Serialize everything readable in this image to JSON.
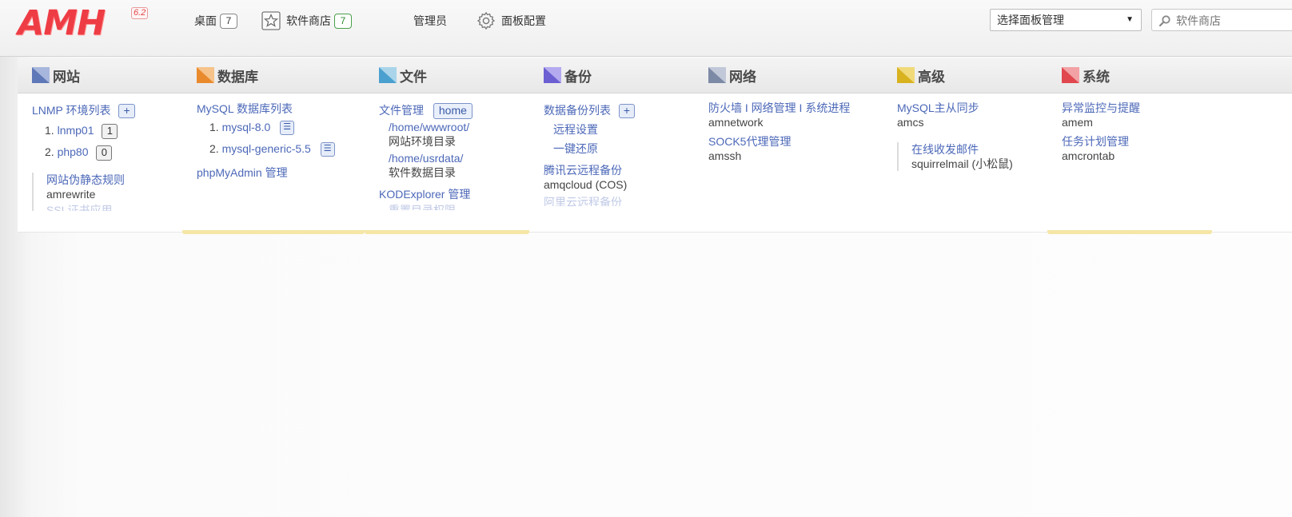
{
  "header": {
    "logo_text": "AMH",
    "version": "6.2",
    "nav": {
      "desktop": {
        "label": "桌面",
        "count": "7"
      },
      "store": {
        "label": "软件商店",
        "count": "7"
      },
      "admin": {
        "label": "管理员"
      },
      "config": {
        "label": "面板配置"
      }
    },
    "panel_select": {
      "selected": "选择面板管理"
    },
    "search": {
      "placeholder": "软件商店"
    }
  },
  "categories": {
    "website": "网站",
    "database": "数据库",
    "files": "文件",
    "backup": "备份",
    "network": "网络",
    "advanced": "高级",
    "system": "系统"
  },
  "website": {
    "lnmp_list": "LNMP 环境列表",
    "add": "+",
    "envs": [
      {
        "index": "1.",
        "name": "lnmp01",
        "count": "1"
      },
      {
        "index": "2.",
        "name": "php80",
        "count": "0"
      }
    ],
    "rewrite_title": "网站伪静态规则",
    "rewrite_mod": "amrewrite",
    "ssl_faded": "SSL证书应用"
  },
  "database": {
    "mysql_list": "MySQL 数据库列表",
    "dbs": [
      {
        "index": "1.",
        "name": "mysql-8.0",
        "icon": "☰"
      },
      {
        "index": "2.",
        "name": "mysql-generic-5.5",
        "icon": "☰"
      }
    ],
    "phpmyadmin": "phpMyAdmin 管理"
  },
  "files": {
    "manage": "文件管理",
    "home_btn": "home",
    "wwwroot_path": "/home/wwwroot/",
    "wwwroot_desc": "网站环境目录",
    "usrdata_path": "/home/usrdata/",
    "usrdata_desc": "软件数据目录",
    "kod": "KODExplorer 管理",
    "faded": "重置目录权限"
  },
  "backup": {
    "list": "数据备份列表",
    "add": "+",
    "remote": "远程设置",
    "restore": "一键还原",
    "tencent": "腾讯云远程备份",
    "tencent_mod": "amqcloud (COS)",
    "aliyun_faded": "阿里云远程备份"
  },
  "network": {
    "firewall": "防火墙 I 网络管理 I 系统进程",
    "firewall_mod": "amnetwork",
    "sock5": "SOCK5代理管理",
    "sock5_mod": "amssh"
  },
  "advanced": {
    "mysql_sync": "MySQL主从同步",
    "mysql_sync_mod": "amcs",
    "mail": "在线收发邮件",
    "mail_mod": "squirrelmail (小松鼠)"
  },
  "system": {
    "monitor": "异常监控与提醒",
    "monitor_mod": "amem",
    "cron": "任务计划管理",
    "cron_mod": "amcrontab"
  },
  "colors": {
    "brand": "#ee3c45",
    "link": "#4c68b8",
    "highlight": "#f5e6a6"
  }
}
